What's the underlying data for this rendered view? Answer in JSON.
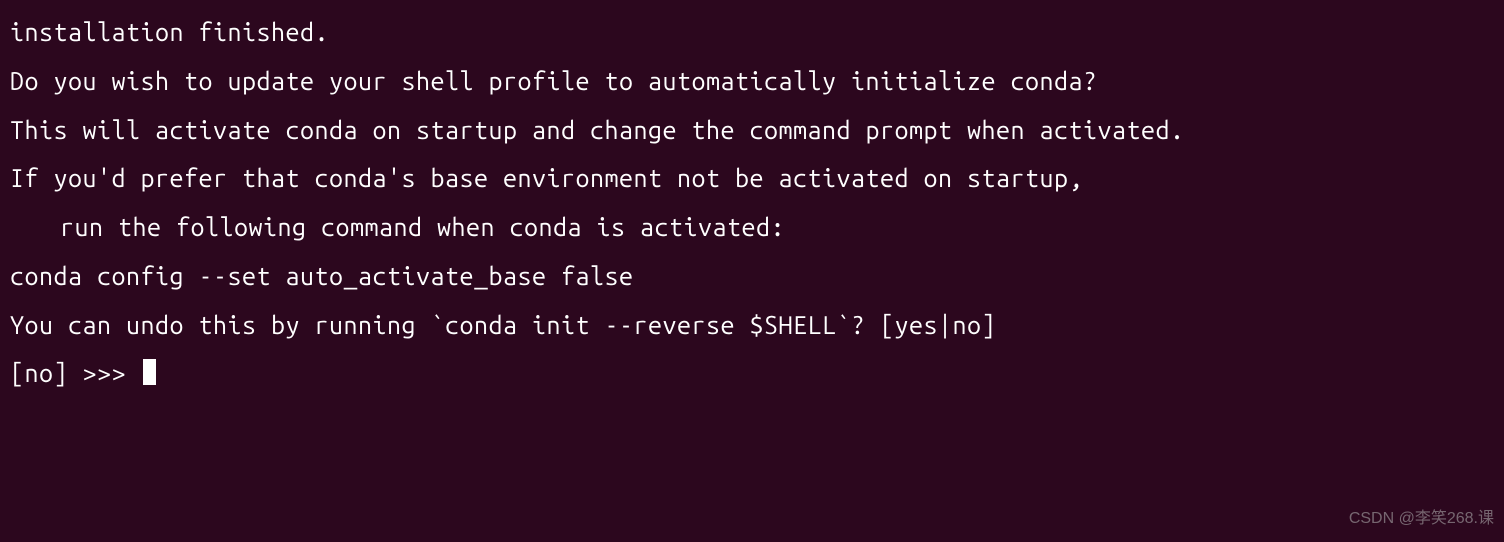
{
  "terminal": {
    "lines": {
      "l1": "installation finished.",
      "l2": "Do you wish to update your shell profile to automatically initialize conda?",
      "l3": "This will activate conda on startup and change the command prompt when activated.",
      "l4": "If you'd prefer that conda's base environment not be activated on startup,",
      "l5": "run the following command when conda is activated:",
      "l6": "",
      "l7": "conda config --set auto_activate_base false",
      "l8": "",
      "l9": "You can undo this by running `conda init --reverse $SHELL`? [yes|no]",
      "prompt": "[no] >>> "
    }
  },
  "watermark": {
    "text": "CSDN @李笑268.课"
  }
}
